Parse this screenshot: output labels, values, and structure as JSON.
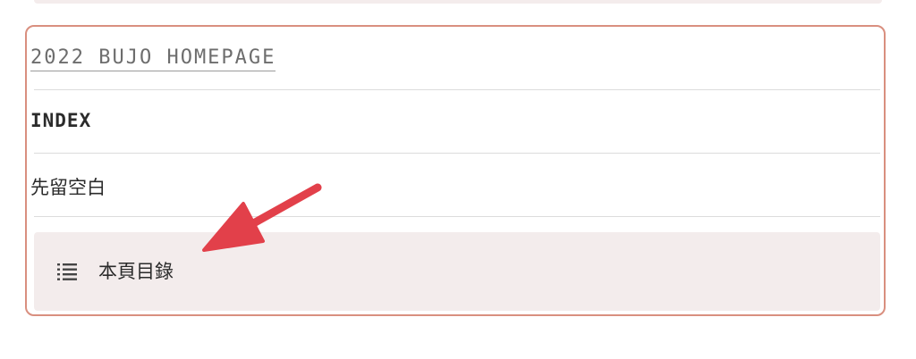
{
  "block_link": {
    "label": "2022 BUJO HOMEPAGE"
  },
  "heading": {
    "label": "INDEX"
  },
  "note": {
    "label": "先留空白"
  },
  "toc_block": {
    "label": "本頁目錄",
    "icon": "list-icon"
  },
  "colors": {
    "card_border": "#d98f7f",
    "toc_background": "#f3ecec",
    "arrow": "#e2404a"
  }
}
